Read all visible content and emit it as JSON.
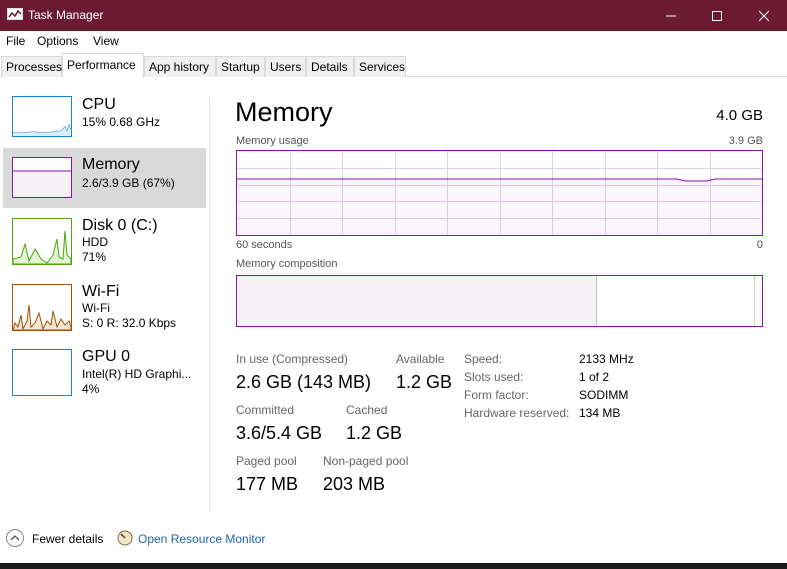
{
  "window": {
    "title": "Task Manager",
    "accent_color": "#6b1a34"
  },
  "menu": [
    "File",
    "Options",
    "View"
  ],
  "tabs": [
    "Processes",
    "Performance",
    "App history",
    "Startup",
    "Users",
    "Details",
    "Services"
  ],
  "active_tab": "Performance",
  "sidebar": {
    "items": [
      {
        "name": "CPU",
        "line1": "15%  0.68 GHz",
        "line2": "",
        "color": "#1f82c9"
      },
      {
        "name": "Memory",
        "line1": "2.6/3.9 GB (67%)",
        "line2": "",
        "color": "#8b12ae",
        "selected": true
      },
      {
        "name": "Disk 0 (C:)",
        "line1": "HDD",
        "line2": "71%",
        "color": "#4da60c"
      },
      {
        "name": "Wi-Fi",
        "line1": "Wi-Fi",
        "line2": "S: 0  R: 32.0 Kbps",
        "color": "#a74f01"
      },
      {
        "name": "GPU 0",
        "line1": "Intel(R) HD Graphi...",
        "line2": "4%",
        "color": "#1f82c9"
      }
    ]
  },
  "main": {
    "title": "Memory",
    "total": "4.0 GB",
    "usage_label": "Memory usage",
    "usage_max": "3.9 GB",
    "time_left": "60 seconds",
    "time_right": "0",
    "usage_fraction": 0.67,
    "composition_label": "Memory composition",
    "composition_inuse_fraction": 0.685,
    "composition_standby_fraction": 0.3,
    "stats": {
      "in_use_label": "In use (Compressed)",
      "in_use_value": "2.6 GB (143 MB)",
      "available_label": "Available",
      "available_value": "1.2 GB",
      "committed_label": "Committed",
      "committed_value": "3.6/5.4 GB",
      "cached_label": "Cached",
      "cached_value": "1.2 GB",
      "paged_label": "Paged pool",
      "paged_value": "177 MB",
      "nonpaged_label": "Non-paged pool",
      "nonpaged_value": "203 MB"
    },
    "specs": [
      {
        "label": "Speed:",
        "value": "2133 MHz"
      },
      {
        "label": "Slots used:",
        "value": "1 of 2"
      },
      {
        "label": "Form factor:",
        "value": "SODIMM"
      },
      {
        "label": "Hardware reserved:",
        "value": "134 MB"
      }
    ]
  },
  "footer": {
    "fewer_details": "Fewer details",
    "open_resource_monitor": "Open Resource Monitor"
  }
}
